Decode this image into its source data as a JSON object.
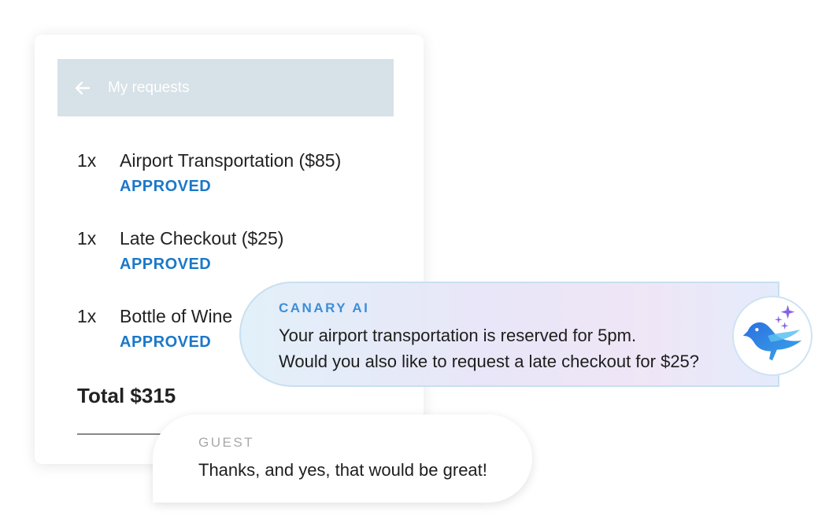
{
  "requests_panel": {
    "header_title": "My requests",
    "items": [
      {
        "qty": "1x",
        "name": "Airport Transportation ($85)",
        "status": "APPROVED"
      },
      {
        "qty": "1x",
        "name": "Late Checkout ($25)",
        "status": "APPROVED"
      },
      {
        "qty": "1x",
        "name": "Bottle of Wine",
        "status": "APPROVED"
      }
    ],
    "total": "Total $315"
  },
  "ai_message": {
    "sender": "CANARY AI",
    "line1": "Your airport transportation is reserved for 5pm.",
    "line2": "Would you also like to request a late checkout for $25?"
  },
  "guest_message": {
    "sender": "GUEST",
    "text": "Thanks, and yes, that would be great!"
  },
  "colors": {
    "header_bg": "#d7e1e8",
    "status": "#1b78c8",
    "ai_label": "#3d8ed6"
  },
  "icons": {
    "back": "arrow-left-icon",
    "avatar": "canary-bird-icon"
  }
}
